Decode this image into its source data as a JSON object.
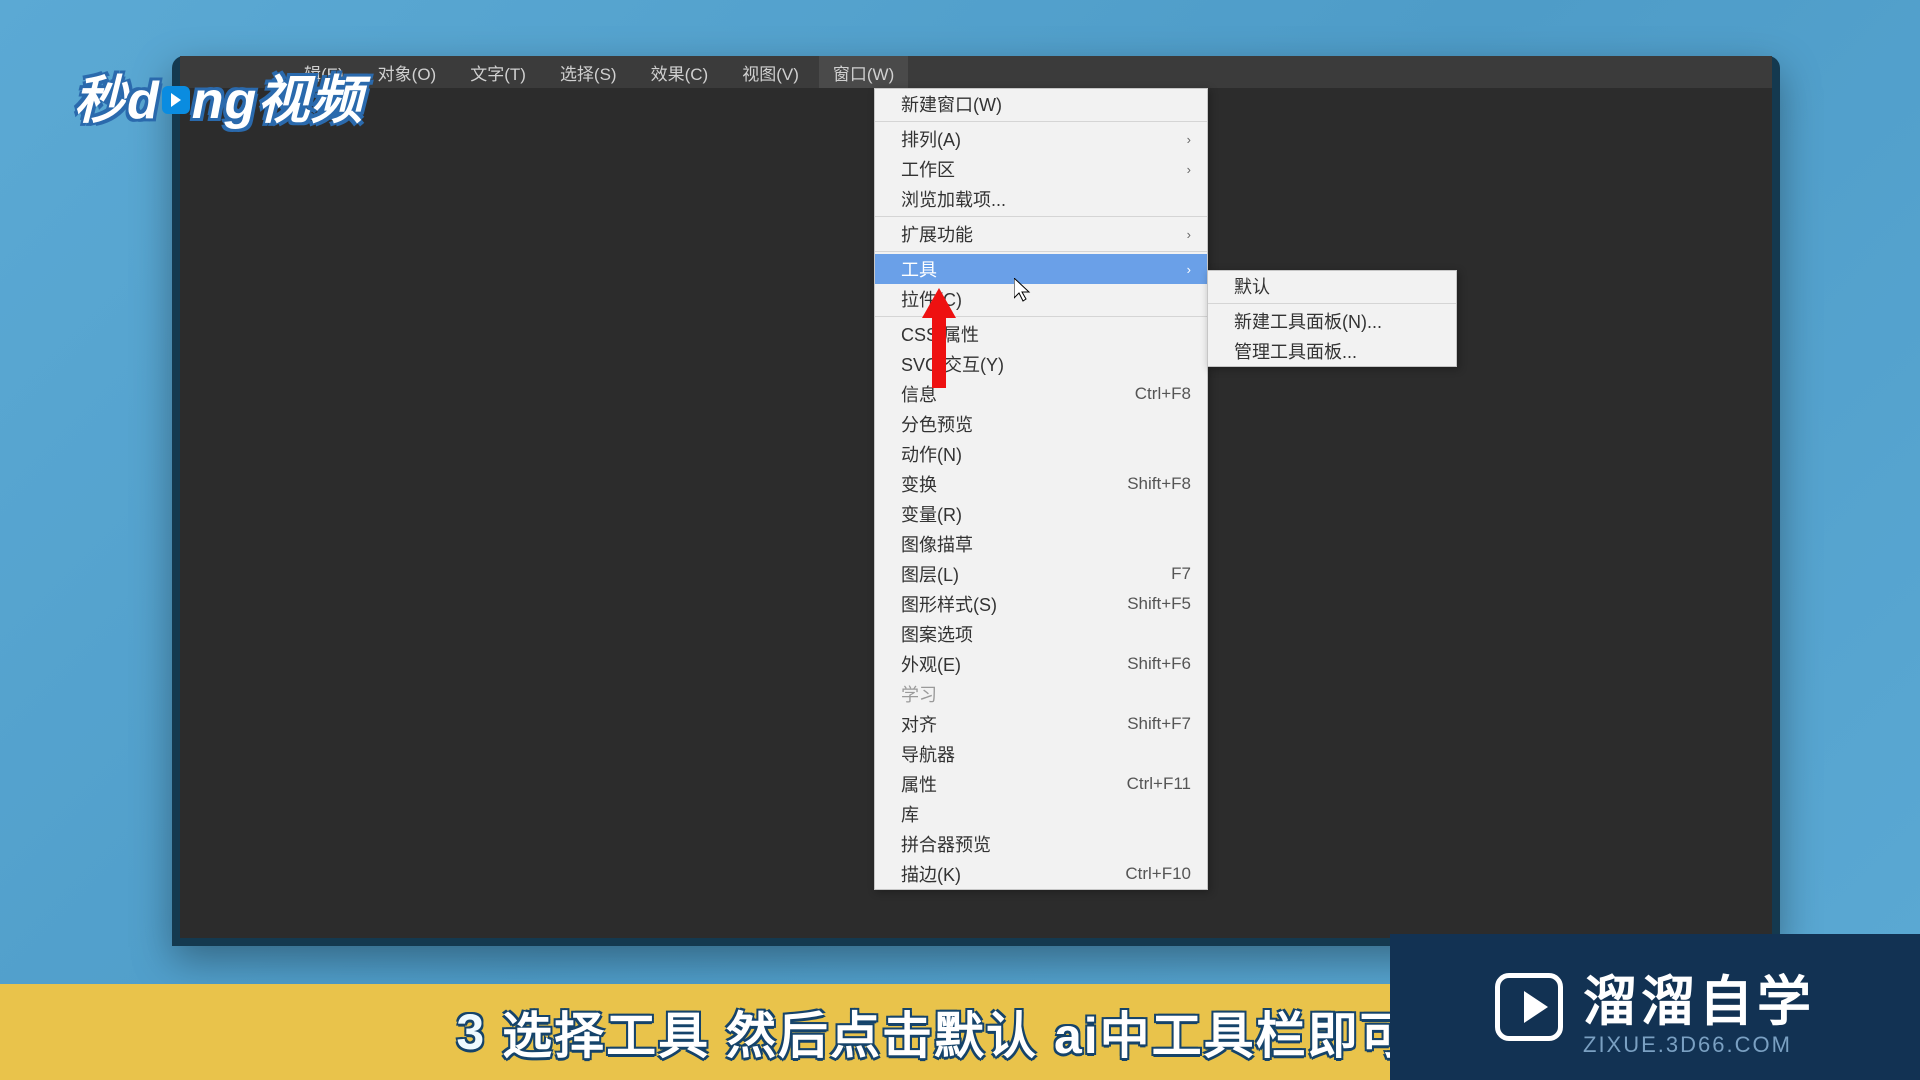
{
  "logo_text": "秒dong视频",
  "caption": {
    "number": "3",
    "text": "选择工具 然后点击默认 ai中工具栏即可显"
  },
  "brand": {
    "cn": "溜溜自学",
    "url": "ZIXUE.3D66.COM"
  },
  "menubar": [
    {
      "label": "辑(E)"
    },
    {
      "label": "对象(O)"
    },
    {
      "label": "文字(T)"
    },
    {
      "label": "选择(S)"
    },
    {
      "label": "效果(C)"
    },
    {
      "label": "视图(V)"
    },
    {
      "label": "窗口(W)"
    }
  ],
  "dropdown": [
    {
      "label": "新建窗口(W)",
      "type": "item"
    },
    {
      "type": "sep"
    },
    {
      "label": "排列(A)",
      "type": "sub"
    },
    {
      "label": "工作区",
      "type": "sub"
    },
    {
      "label": "浏览加载项...",
      "type": "item"
    },
    {
      "type": "sep"
    },
    {
      "label": "扩展功能",
      "type": "sub"
    },
    {
      "type": "sep"
    },
    {
      "label": "工具",
      "type": "sub",
      "highlight": true
    },
    {
      "label": "拉件(C)",
      "type": "item"
    },
    {
      "type": "sep"
    },
    {
      "label": "CSS 属性",
      "type": "item"
    },
    {
      "label": "SVG 交互(Y)",
      "type": "item"
    },
    {
      "label": "信息",
      "shortcut": "Ctrl+F8",
      "type": "item"
    },
    {
      "label": "分色预览",
      "type": "item"
    },
    {
      "label": "动作(N)",
      "type": "item"
    },
    {
      "label": "变换",
      "shortcut": "Shift+F8",
      "type": "item"
    },
    {
      "label": "变量(R)",
      "type": "item"
    },
    {
      "label": "图像描草",
      "type": "item"
    },
    {
      "label": "图层(L)",
      "shortcut": "F7",
      "type": "item"
    },
    {
      "label": "图形样式(S)",
      "shortcut": "Shift+F5",
      "type": "item"
    },
    {
      "label": "图案选项",
      "type": "item"
    },
    {
      "label": "外观(E)",
      "shortcut": "Shift+F6",
      "type": "item"
    },
    {
      "label": "学习",
      "type": "item",
      "disabled": true
    },
    {
      "label": "对齐",
      "shortcut": "Shift+F7",
      "type": "item"
    },
    {
      "label": "导航器",
      "type": "item"
    },
    {
      "label": "属性",
      "shortcut": "Ctrl+F11",
      "type": "item"
    },
    {
      "label": "库",
      "type": "item"
    },
    {
      "label": "拼合器预览",
      "type": "item"
    },
    {
      "label": "描边(K)",
      "shortcut": "Ctrl+F10",
      "type": "item"
    }
  ],
  "submenu": [
    {
      "label": "默认"
    },
    {
      "type": "sep"
    },
    {
      "label": "新建工具面板(N)..."
    },
    {
      "label": "管理工具面板..."
    }
  ]
}
